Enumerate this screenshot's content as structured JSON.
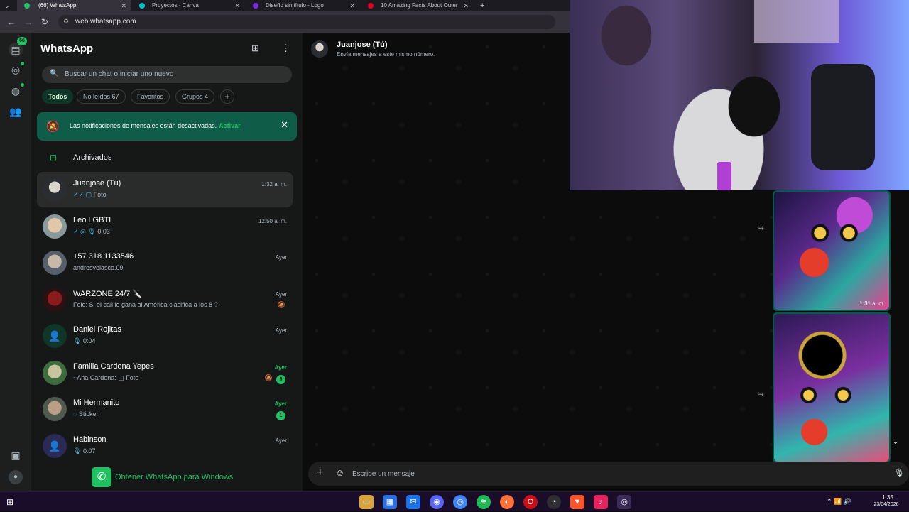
{
  "browser": {
    "tabs": [
      {
        "title": "(66) WhatsApp",
        "active": true,
        "icon": "whatsapp-icon",
        "color": "#21c063"
      },
      {
        "title": "Proyectos - Canva",
        "active": false,
        "icon": "canva-icon",
        "color": "#00c4cc"
      },
      {
        "title": "Diseño sin título - Logo",
        "active": false,
        "icon": "canva-icon",
        "color": "#7d2ae8"
      },
      {
        "title": "10 Amazing Facts About Outer",
        "active": false,
        "icon": "pinterest-icon",
        "color": "#e60023"
      }
    ],
    "url": "web.whatsapp.com"
  },
  "rail": {
    "chats_badge": "66"
  },
  "sidebar": {
    "title": "WhatsApp",
    "search_placeholder": "Buscar un chat o iniciar uno nuevo",
    "filters": [
      {
        "label": "Todos",
        "count": "",
        "active": true
      },
      {
        "label": "No leídos",
        "count": "67",
        "active": false
      },
      {
        "label": "Favoritos",
        "count": "",
        "active": false
      },
      {
        "label": "Grupos",
        "count": "4",
        "active": false
      }
    ],
    "notification": {
      "text": "Las notificaciones de mensajes están desactivadas.",
      "link": "Activar"
    },
    "archived_label": "Archivados",
    "chats": [
      {
        "name": "Juanjose (Tú)",
        "preview": "Foto",
        "prefix": "✓✓ ▢ ",
        "time": "1:32 a. m.",
        "selected": true,
        "unread": "",
        "muted": false,
        "time_green": false
      },
      {
        "name": "Leo LGBTI",
        "preview": "0:03",
        "prefix": "✓ ◎ 🎙 ",
        "time": "12:50 a. m.",
        "selected": false,
        "unread": "",
        "muted": false,
        "time_green": false
      },
      {
        "name": "+57 318 1133546",
        "preview": "andresvelasco.09",
        "prefix": "",
        "time": "Ayer",
        "selected": false,
        "unread": "",
        "muted": false,
        "time_green": false
      },
      {
        "name": "WARZONE 24/7 🔪",
        "preview": "Felo: Si el cali le gana al América clasifica a los 8 ?",
        "prefix": "",
        "time": "Ayer",
        "selected": false,
        "unread": "",
        "muted": true,
        "time_green": false
      },
      {
        "name": "Daniel Rojitas",
        "preview": "0:04",
        "prefix": "🎙 ",
        "time": "Ayer",
        "selected": false,
        "unread": "",
        "muted": false,
        "time_green": false
      },
      {
        "name": "Familia Cardona Yepes",
        "preview": "~Ana Cardona: ▢ Foto",
        "prefix": "",
        "time": "Ayer",
        "selected": false,
        "unread": "5",
        "muted": true,
        "time_green": true
      },
      {
        "name": "Mi Hermanito",
        "preview": "Sticker",
        "prefix": "◌ ",
        "time": "Ayer",
        "selected": false,
        "unread": "1",
        "muted": false,
        "time_green": true
      },
      {
        "name": "Habinson",
        "preview": "0:07",
        "prefix": "🎙 ",
        "time": "Ayer",
        "selected": false,
        "unread": "",
        "muted": false,
        "time_green": false
      }
    ],
    "get_windows": "Obtener WhatsApp para Windows"
  },
  "chat": {
    "name": "Juanjose (Tú)",
    "subtitle": "Envía mensajes a este mismo número.",
    "first_image_time": "1:31 a. m.",
    "composer_placeholder": "Escribe un mensaje"
  },
  "taskbar": {
    "time": "1:35",
    "date": "23/04/2026"
  }
}
